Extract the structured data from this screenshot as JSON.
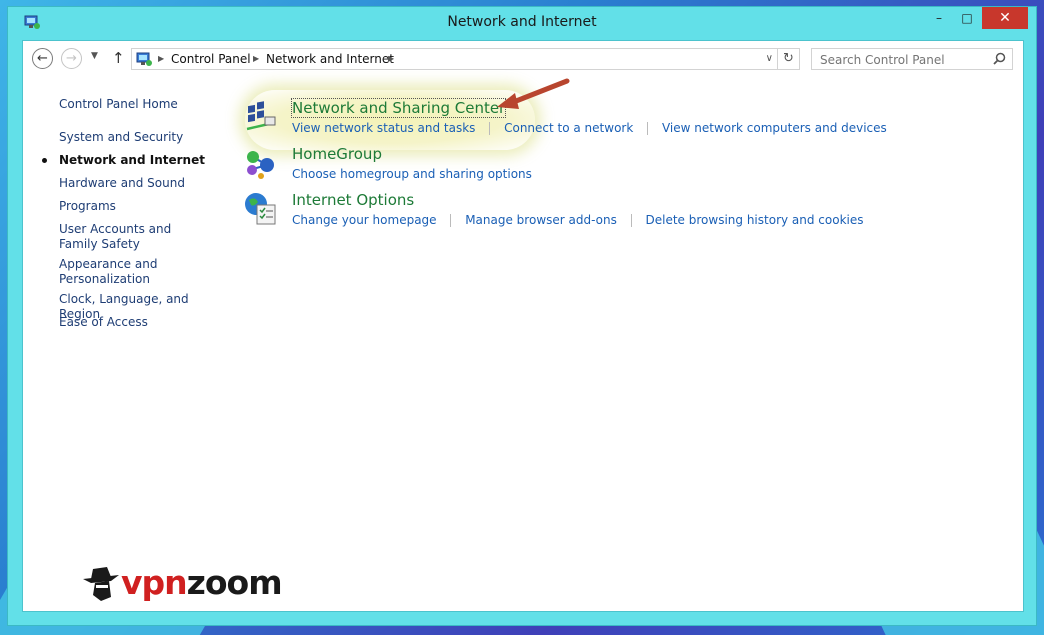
{
  "window": {
    "title": "Network and Internet",
    "minimize_label": "–",
    "maximize_label": "□",
    "close_label": "✕"
  },
  "address_bar": {
    "breadcrumbs": [
      "Control Panel",
      "Network and Internet"
    ]
  },
  "search": {
    "placeholder": "Search Control Panel"
  },
  "sidebar": {
    "home": "Control Panel Home",
    "items": [
      {
        "label": "System and Security",
        "active": false
      },
      {
        "label": "Network and Internet",
        "active": true
      },
      {
        "label": "Hardware and Sound",
        "active": false
      },
      {
        "label": "Programs",
        "active": false
      },
      {
        "label": "User Accounts and Family Safety",
        "active": false
      },
      {
        "label": "Appearance and Personalization",
        "active": false
      },
      {
        "label": "Clock, Language, and Region",
        "active": false
      },
      {
        "label": "Ease of Access",
        "active": false
      }
    ]
  },
  "categories": [
    {
      "title": "Network and Sharing Center",
      "icon": "network-sharing-icon",
      "links": [
        "View network status and tasks",
        "Connect to a network",
        "View network computers and devices"
      ]
    },
    {
      "title": "HomeGroup",
      "icon": "homegroup-icon",
      "links": [
        "Choose homegroup and sharing options"
      ]
    },
    {
      "title": "Internet Options",
      "icon": "internet-options-icon",
      "links": [
        "Change your homepage",
        "Manage browser add-ons",
        "Delete browsing history and cookies"
      ]
    }
  ],
  "watermark": {
    "brand_red": "vpn",
    "brand_dark": "zoom"
  },
  "colors": {
    "title_bar": "#62e0e8",
    "close_button": "#c8372c",
    "category_title": "#1d7a37",
    "link": "#1a5fb5",
    "annotation_arrow": "#b8452e"
  }
}
